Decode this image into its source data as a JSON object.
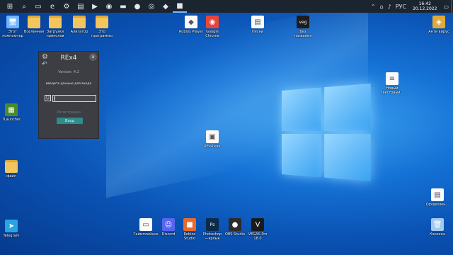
{
  "taskbar": {
    "items": [
      {
        "icon": "windows-icon",
        "glyph": "⊞"
      },
      {
        "icon": "search-icon",
        "glyph": "⌕"
      },
      {
        "icon": "task-view-icon",
        "glyph": "▭"
      },
      {
        "icon": "edge-icon",
        "glyph": "e"
      },
      {
        "icon": "settings-icon",
        "glyph": "⚙"
      },
      {
        "icon": "file-explorer-icon",
        "glyph": "▤"
      },
      {
        "icon": "media-icon",
        "glyph": "▶"
      },
      {
        "icon": "chrome-icon",
        "glyph": "◉"
      },
      {
        "icon": "folder-icon",
        "glyph": "▬"
      },
      {
        "icon": "obs-icon",
        "glyph": "●"
      },
      {
        "icon": "record-icon",
        "glyph": "◎"
      },
      {
        "icon": "roblox-icon",
        "glyph": "◆"
      },
      {
        "icon": "roblox-studio-icon",
        "glyph": "■"
      }
    ],
    "tray": {
      "lang": "РУС",
      "time": "16:42",
      "date": "20.12.2022"
    }
  },
  "desktop": {
    "icons_left": [
      {
        "label": "Этот\nкомпьютер",
        "icon": "computer-icon",
        "type": "app",
        "color": "#6fb3ff",
        "glyph": "🖥"
      },
      {
        "label": "Вселенная",
        "icon": "folder-icon",
        "type": "folder",
        "glyph": ""
      },
      {
        "label": "Загрузки\nприколов",
        "icon": "folder-shortcut-icon",
        "type": "folder",
        "glyph": ""
      },
      {
        "label": "Алигатор",
        "icon": "folder-icon",
        "type": "folder",
        "glyph": ""
      },
      {
        "label": "Это\nпрограммы",
        "icon": "folder-icon",
        "type": "folder",
        "glyph": ""
      }
    ],
    "icons_top_mid": [
      {
        "label": "Roblox Player",
        "icon": "roblox-icon",
        "type": "doc",
        "glyph": "◆"
      },
      {
        "label": "Google\nChrome",
        "icon": "chrome-icon",
        "type": "app",
        "color": "#e8453c",
        "glyph": "◉"
      },
      {
        "label": "Песни",
        "icon": "file-icon",
        "type": "doc",
        "glyph": "▤"
      },
      {
        "label": "Без\nназвания",
        "icon": "veg-file-icon",
        "type": "app",
        "color": "#1c1c1c",
        "glyph": "veg"
      }
    ],
    "icon_top_right": {
      "label": "Анти вирус",
      "icon": "antivirus-icon",
      "type": "app",
      "color": "#e0a93a",
      "glyph": "◈"
    },
    "icon_new_doc": {
      "label": "Новый\nтекстовый...",
      "icon": "text-file-icon",
      "type": "doc",
      "glyph": "≡"
    },
    "icon_minecraft": {
      "label": "TLauncher",
      "icon": "minecraft-icon",
      "type": "app",
      "color": "#4a8a2a",
      "glyph": "▦"
    },
    "icon_file2": {
      "label": "файл",
      "icon": "file-icon",
      "type": "folder",
      "glyph": ""
    },
    "icon_rex_center": {
      "label": "REx4.exe",
      "icon": "rex-file-icon",
      "type": "doc",
      "glyph": "▣"
    },
    "icon_telegram": {
      "label": "Telegram",
      "icon": "telegram-icon",
      "type": "app",
      "color": "#2aa3e0",
      "glyph": "➤"
    },
    "icon_design": {
      "label": "Оформлен...",
      "icon": "document-icon",
      "type": "doc",
      "glyph": "▤"
    },
    "icon_trash": {
      "label": "Корзина",
      "icon": "recycle-bin-icon",
      "type": "app",
      "color": "#9fc9f0",
      "glyph": "🗑"
    },
    "icons_bottom": [
      {
        "label": "Геймплейкнк",
        "icon": "video-file-icon",
        "type": "doc",
        "glyph": "▭"
      },
      {
        "label": "Discord",
        "icon": "discord-icon",
        "type": "app",
        "color": "#5865f2",
        "glyph": "☺"
      },
      {
        "label": "Roblox\nStudio",
        "icon": "roblox-studio-icon",
        "type": "app",
        "color": "#e96a2b",
        "glyph": "■"
      },
      {
        "label": "Photoshop\n—ярлык",
        "icon": "photoshop-icon",
        "type": "app",
        "color": "#0b2b4a",
        "glyph": "Ps"
      },
      {
        "label": "OBS Studio",
        "icon": "obs-icon",
        "type": "app",
        "color": "#2b2b2b",
        "glyph": "●"
      },
      {
        "label": "VEGAS Pro\n18.0",
        "icon": "vegas-icon",
        "type": "app",
        "color": "#1a1a1a",
        "glyph": "V"
      }
    ]
  },
  "rex_window": {
    "title": "REx4",
    "version": "Version: 4.2",
    "prompt": "введите данные для входа",
    "input_value": "",
    "hint": "Регистрация",
    "login_button": "Вход",
    "close_glyph": "x",
    "gear_glyph": "⚙",
    "back_glyph": "↶",
    "user_glyph": "☺"
  }
}
